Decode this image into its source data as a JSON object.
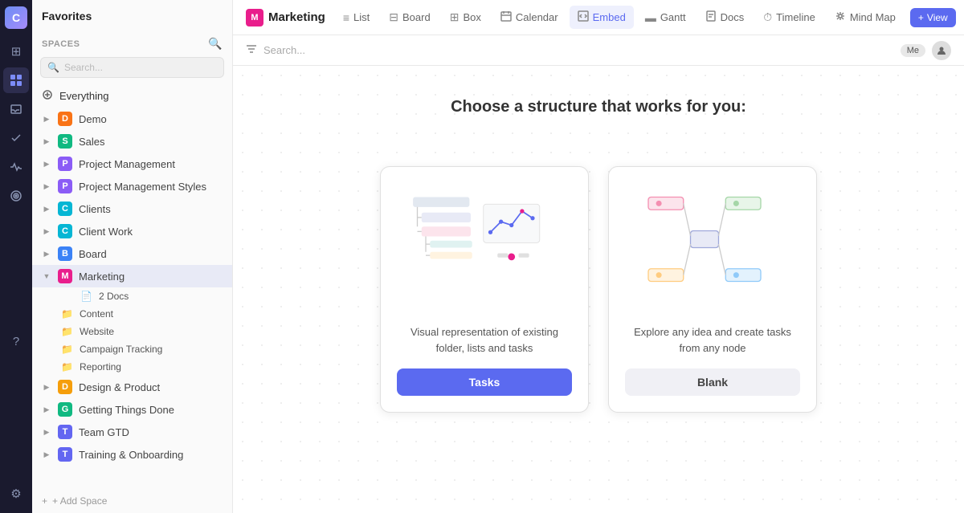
{
  "app": {
    "logo": "C"
  },
  "rail": {
    "icons": [
      {
        "name": "home-icon",
        "symbol": "⊞",
        "active": false
      },
      {
        "name": "inbox-icon",
        "symbol": "⬚",
        "active": false
      },
      {
        "name": "check-icon",
        "symbol": "✓",
        "active": false
      },
      {
        "name": "grid-icon",
        "symbol": "⋮⋮",
        "active": true
      },
      {
        "name": "pulse-icon",
        "symbol": "〜",
        "active": false
      },
      {
        "name": "flag-icon",
        "symbol": "⚑",
        "active": false
      },
      {
        "name": "question-icon",
        "symbol": "?",
        "active": false
      },
      {
        "name": "settings-icon",
        "symbol": "⚙",
        "active": false
      }
    ]
  },
  "sidebar": {
    "favorites_label": "Favorites",
    "spaces_label": "Spaces",
    "search_placeholder": "Search...",
    "everything_label": "Everything",
    "items": [
      {
        "id": "demo",
        "label": "Demo",
        "icon": "D",
        "color": "#f97316",
        "level": 0
      },
      {
        "id": "sales",
        "label": "Sales",
        "icon": "S",
        "color": "#10b981",
        "level": 0
      },
      {
        "id": "project-management",
        "label": "Project Management",
        "icon": "P",
        "color": "#8b5cf6",
        "level": 0
      },
      {
        "id": "project-management-styles",
        "label": "Project Management Styles",
        "icon": "P",
        "color": "#8b5cf6",
        "level": 0
      },
      {
        "id": "clients",
        "label": "Clients",
        "icon": "C",
        "color": "#06b6d4",
        "level": 0
      },
      {
        "id": "client-work",
        "label": "Client Work",
        "icon": "C",
        "color": "#06b6d4",
        "level": 0
      },
      {
        "id": "board",
        "label": "Board",
        "icon": "B",
        "color": "#3b82f6",
        "level": 0
      },
      {
        "id": "marketing",
        "label": "Marketing",
        "icon": "M",
        "color": "#e91e8c",
        "level": 0,
        "active": true
      }
    ],
    "marketing_sub": [
      {
        "id": "docs",
        "label": "2 Docs",
        "icon": "doc"
      },
      {
        "id": "content",
        "label": "Content",
        "icon": "folder"
      },
      {
        "id": "website",
        "label": "Website",
        "icon": "folder"
      },
      {
        "id": "campaign-tracking",
        "label": "Campaign Tracking",
        "icon": "folder"
      },
      {
        "id": "reporting",
        "label": "Reporting",
        "icon": "folder"
      }
    ],
    "more_items": [
      {
        "id": "design-product",
        "label": "Design & Product",
        "icon": "D",
        "color": "#f59e0b"
      },
      {
        "id": "getting-things-done",
        "label": "Getting Things Done",
        "icon": "G",
        "color": "#10b981"
      },
      {
        "id": "team-gtd",
        "label": "Team GTD",
        "icon": "T",
        "color": "#6366f1"
      },
      {
        "id": "training-onboarding",
        "label": "Training & Onboarding",
        "icon": "T",
        "color": "#6366f1"
      }
    ],
    "add_space_label": "+ Add Space"
  },
  "topbar": {
    "space_name": "Marketing",
    "space_icon": "M",
    "tabs": [
      {
        "id": "list",
        "label": "List",
        "icon": "≡"
      },
      {
        "id": "board",
        "label": "Board",
        "icon": "⊟"
      },
      {
        "id": "box",
        "label": "Box",
        "icon": "⊞"
      },
      {
        "id": "calendar",
        "label": "Calendar",
        "icon": "📅"
      },
      {
        "id": "embed",
        "label": "Embed",
        "icon": "⧉",
        "active": true
      },
      {
        "id": "gantt",
        "label": "Gantt",
        "icon": "▬"
      },
      {
        "id": "docs",
        "label": "Docs",
        "icon": "📄"
      },
      {
        "id": "timeline",
        "label": "Timeline",
        "icon": "⏱"
      },
      {
        "id": "mind-map",
        "label": "Mind Map",
        "icon": "⬡"
      }
    ],
    "view_label": "View",
    "me_label": "Me"
  },
  "filter_bar": {
    "filter_icon": "⊿",
    "search_placeholder": "Search..."
  },
  "content": {
    "title": "Choose a structure that works for you:",
    "cards": [
      {
        "id": "tasks-card",
        "description": "Visual representation of existing folder, lists and tasks",
        "button_label": "Tasks",
        "button_type": "blue"
      },
      {
        "id": "blank-card",
        "description": "Explore any idea and create tasks from any node",
        "button_label": "Blank",
        "button_type": "light"
      }
    ]
  }
}
